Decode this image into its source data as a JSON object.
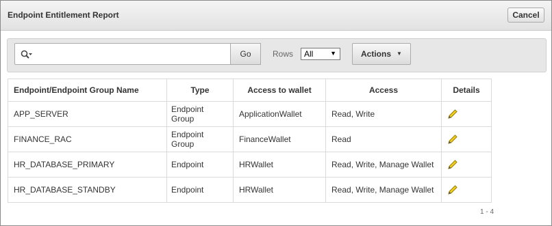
{
  "dialog": {
    "title": "Endpoint Entitlement Report",
    "cancel_label": "Cancel"
  },
  "toolbar": {
    "search_icon": "search-icon",
    "search_value": "",
    "go_label": "Go",
    "rows_label": "Rows",
    "rows_value": "All",
    "actions_label": "Actions"
  },
  "table": {
    "headers": [
      "Endpoint/Endpoint Group Name",
      "Type",
      "Access to wallet",
      "Access",
      "Details"
    ],
    "rows": [
      {
        "name": "APP_SERVER",
        "type": "Endpoint Group",
        "wallet": "ApplicationWallet",
        "access": "Read, Write",
        "details_icon": "pencil-icon"
      },
      {
        "name": "FINANCE_RAC",
        "type": "Endpoint Group",
        "wallet": "FinanceWallet",
        "access": "Read",
        "details_icon": "pencil-icon"
      },
      {
        "name": "HR_DATABASE_PRIMARY",
        "type": "Endpoint",
        "wallet": "HRWallet",
        "access": "Read, Write, Manage Wallet",
        "details_icon": "pencil-icon"
      },
      {
        "name": "HR_DATABASE_STANDBY",
        "type": "Endpoint",
        "wallet": "HRWallet",
        "access": "Read, Write, Manage Wallet",
        "details_icon": "pencil-icon"
      }
    ]
  },
  "pagination": {
    "range": "1 - 4"
  },
  "colors": {
    "title_bar": "#e8e8e8",
    "toolbar": "#e7e7e7",
    "border": "#dadada",
    "pencil": "#e8c200"
  }
}
